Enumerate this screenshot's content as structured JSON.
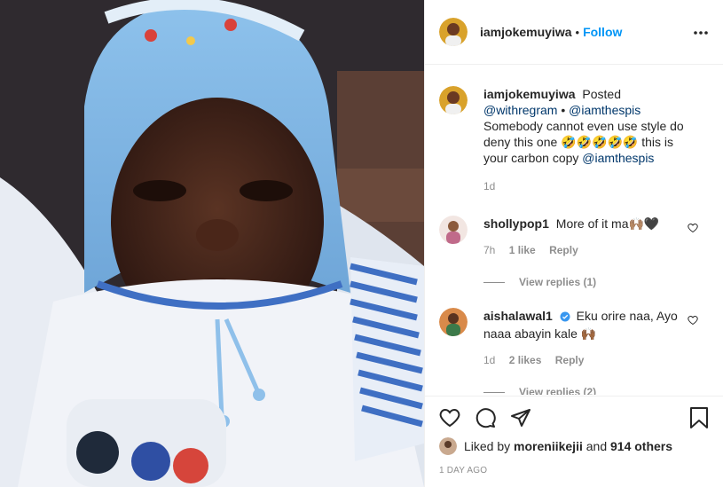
{
  "header": {
    "username": "iamjokemuyiwa",
    "separator": "•",
    "follow_label": "Follow",
    "more_icon": "more-horizontal-icon"
  },
  "caption": {
    "username": "iamjokemuyiwa",
    "text_1": "Posted",
    "mention_1": "@withregram",
    "text_2": "•",
    "mention_2": "@iamthespis",
    "text_3": "Somebody cannot even use style do deny this one 🤣🤣🤣🤣🤣 this is your carbon copy",
    "mention_3": "@iamthespis",
    "time": "1d"
  },
  "comments": [
    {
      "username": "shollypop1",
      "text": "More of it ma🙌🏽🖤",
      "time": "7h",
      "likes": "1 like",
      "reply": "Reply",
      "view_replies": "View replies (1)"
    },
    {
      "username": "aishalawal1",
      "verified": true,
      "text": "Eku orire naa, Ayo naaa abayin kale 🙌🏾",
      "time": "1d",
      "likes": "2 likes",
      "reply": "Reply",
      "view_replies": "View replies (2)"
    }
  ],
  "actions": {
    "like_icon": "heart-icon",
    "comment_icon": "comment-icon",
    "share_icon": "share-icon",
    "save_icon": "bookmark-icon"
  },
  "likes": {
    "prefix": "Liked by",
    "user": "moreniikejii",
    "and": "and",
    "count": "914 others"
  },
  "posted_ago": "1 DAY AGO",
  "colors": {
    "accent": "#0095f6",
    "mention": "#00376b",
    "muted": "#8e8e8e",
    "verified": "#3897f0"
  }
}
